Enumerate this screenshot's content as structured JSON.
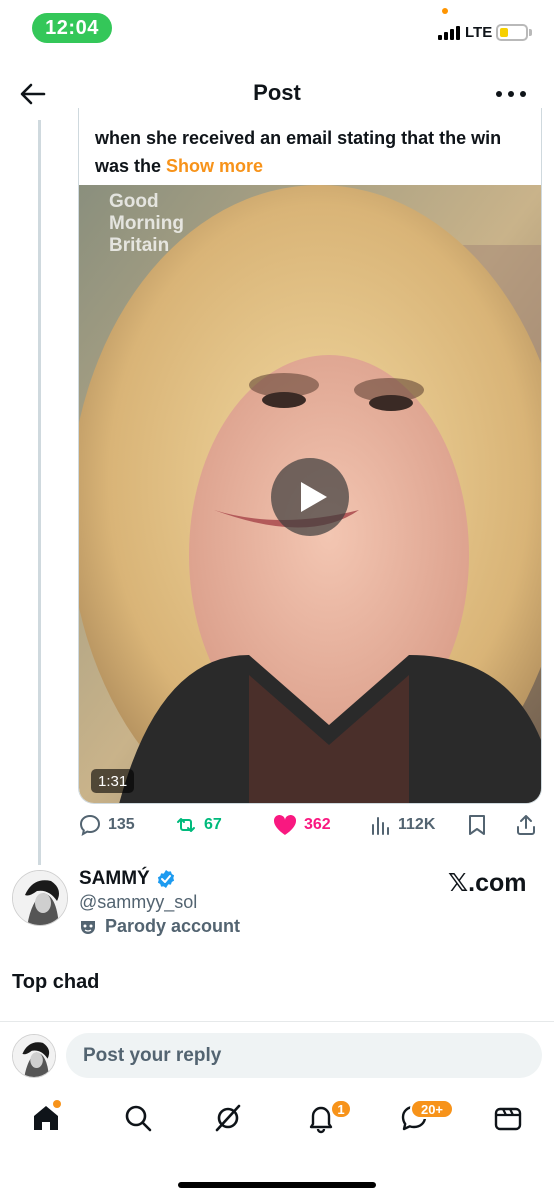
{
  "status_bar": {
    "time": "12:04",
    "network": "LTE",
    "battery_level": 0.35
  },
  "header": {
    "title": "Post"
  },
  "quoted_post": {
    "text": "when she received an email stating that the win was the",
    "show_more": "Show more",
    "video_logo": [
      "Good",
      "Morning",
      "Britain"
    ],
    "duration": "1:31"
  },
  "actions": {
    "replies": "135",
    "reposts": "67",
    "likes": "362",
    "views": "112K"
  },
  "author": {
    "name": "SAMMÝ",
    "handle": "@sammyy_sol",
    "label": "Parody account",
    "verified": true
  },
  "watermark": "𝕏.com",
  "reply_text": "Top chad",
  "composer": {
    "placeholder": "Post your reply"
  },
  "nav": {
    "notifications_badge": "1",
    "messages_badge": "20+"
  },
  "colors": {
    "accent": "#f7931a",
    "like": "#f91880",
    "repost": "#00ba7c",
    "muted": "#536471",
    "verified": "#1d9bf0"
  }
}
